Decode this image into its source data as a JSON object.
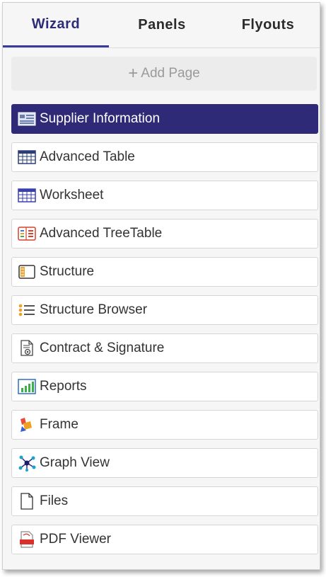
{
  "tabs": [
    {
      "label": "Wizard",
      "active": true
    },
    {
      "label": "Panels",
      "active": false
    },
    {
      "label": "Flyouts",
      "active": false
    }
  ],
  "add_page": {
    "icon": "plus-icon",
    "label": "Add Page"
  },
  "items": [
    {
      "label": "Supplier Information",
      "icon": "info-card-icon",
      "selected": true
    },
    {
      "label": "Advanced Table",
      "icon": "table-icon",
      "selected": false
    },
    {
      "label": "Worksheet",
      "icon": "worksheet-grid-icon",
      "selected": false
    },
    {
      "label": "Advanced TreeTable",
      "icon": "tree-table-icon",
      "selected": false
    },
    {
      "label": "Structure",
      "icon": "structure-icon",
      "selected": false
    },
    {
      "label": "Structure Browser",
      "icon": "list-bullets-icon",
      "selected": false
    },
    {
      "label": "Contract & Signature",
      "icon": "contract-document-icon",
      "selected": false
    },
    {
      "label": "Reports",
      "icon": "bar-chart-icon",
      "selected": false
    },
    {
      "label": "Frame",
      "icon": "frame-icon",
      "selected": false
    },
    {
      "label": "Graph View",
      "icon": "graph-network-icon",
      "selected": false
    },
    {
      "label": "Files",
      "icon": "file-icon",
      "selected": false
    },
    {
      "label": "PDF Viewer",
      "icon": "pdf-icon",
      "selected": false
    }
  ],
  "colors": {
    "accent": "#2f2a78",
    "active_tab_text": "#2c2c7a",
    "add_page_text": "#9a9a9a"
  }
}
